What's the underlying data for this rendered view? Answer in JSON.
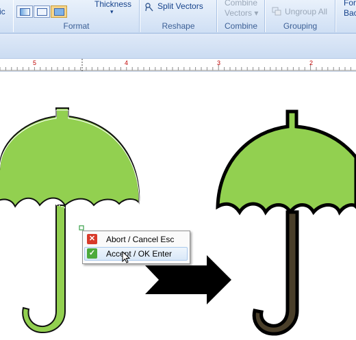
{
  "ribbon": {
    "groups": {
      "format": {
        "label": "Format",
        "cut_text": "ic",
        "thickness_label": "Thickness",
        "thickness_arrow": "▾"
      },
      "reshape": {
        "label": "Reshape",
        "split_vectors_label": "Split Vectors"
      },
      "combine": {
        "label": "Combine",
        "combine_vectors_line1": "Combine",
        "combine_vectors_line2": "Vectors ▾"
      },
      "grouping": {
        "label": "Grouping",
        "ungroup_all_label": "Ungroup All"
      },
      "cut": {
        "line1": "For",
        "line2": "Bac"
      }
    }
  },
  "ruler": {
    "labels": [
      "5",
      "4",
      "3",
      "2"
    ]
  },
  "context_menu": {
    "items": [
      {
        "label": "Abort / Cancel Esc",
        "icon": "close-icon"
      },
      {
        "label": "Accept / OK  Enter",
        "icon": "check-icon"
      }
    ]
  },
  "colors": {
    "umbrella_fill": "#92d050",
    "accept_green": "#4caa3c",
    "abort_red": "#d83a2a",
    "ribbon_text": "#15428b"
  }
}
